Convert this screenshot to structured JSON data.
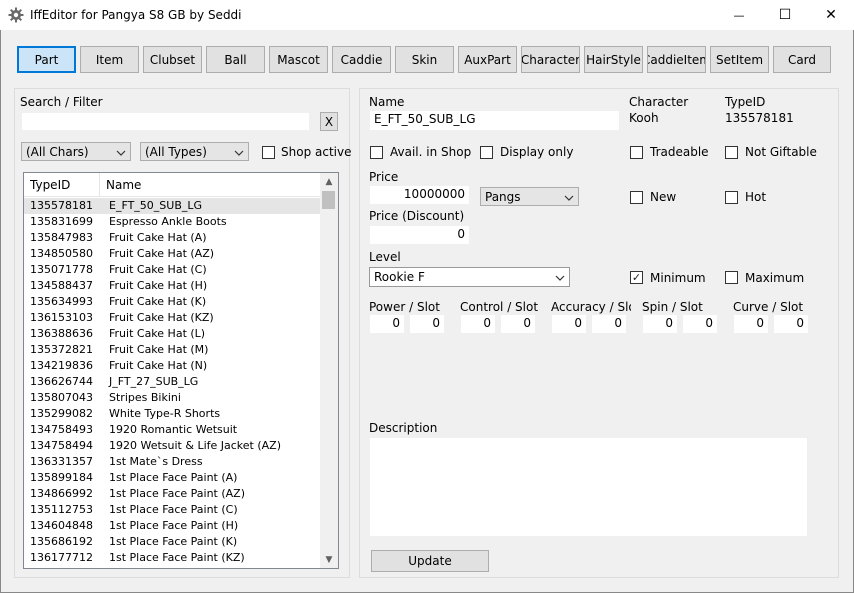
{
  "window": {
    "title": "IffEditor for Pangya S8 GB by Seddi",
    "minimize_glyph": "—",
    "maximize_glyph": "☐",
    "close_glyph": "✕"
  },
  "tabs": [
    "Part",
    "Item",
    "Clubset",
    "Ball",
    "Mascot",
    "Caddie",
    "Skin",
    "AuxPart",
    "Character",
    "HairStyle",
    "CaddieItem",
    "SetItem",
    "Card"
  ],
  "search": {
    "label": "Search / Filter",
    "value": "",
    "clear_label": "X",
    "char_filter": "(All Chars)",
    "type_filter": "(All Types)",
    "shop_active_label": "Shop active"
  },
  "list": {
    "col_typeid": "TypeID",
    "col_name": "Name",
    "scroll_up": "▲",
    "scroll_down": "▼",
    "rows": [
      {
        "id": "135578181",
        "name": "E_FT_50_SUB_LG"
      },
      {
        "id": "135831699",
        "name": "Espresso Ankle Boots"
      },
      {
        "id": "135847983",
        "name": "Fruit Cake Hat (A)"
      },
      {
        "id": "134850580",
        "name": "Fruit Cake Hat (AZ)"
      },
      {
        "id": "135071778",
        "name": "Fruit Cake Hat (C)"
      },
      {
        "id": "134588437",
        "name": "Fruit Cake Hat (H)"
      },
      {
        "id": "135634993",
        "name": "Fruit Cake Hat (K)"
      },
      {
        "id": "136153103",
        "name": "Fruit Cake Hat (KZ)"
      },
      {
        "id": "136388636",
        "name": "Fruit Cake Hat (L)"
      },
      {
        "id": "135372821",
        "name": "Fruit Cake Hat (M)"
      },
      {
        "id": "134219836",
        "name": "Fruit Cake Hat (N)"
      },
      {
        "id": "136626744",
        "name": "J_FT_27_SUB_LG"
      },
      {
        "id": "135807043",
        "name": "Stripes Bikini"
      },
      {
        "id": "135299082",
        "name": "White Type-R Shorts"
      },
      {
        "id": "134758493",
        "name": "1920 Romantic Wetsuit"
      },
      {
        "id": "134758494",
        "name": "1920 Wetsuit & Life Jacket (AZ)"
      },
      {
        "id": "136331357",
        "name": "1st Mate`s Dress"
      },
      {
        "id": "135899184",
        "name": "1st Place Face Paint (A)"
      },
      {
        "id": "134866992",
        "name": "1st Place Face Paint (AZ)"
      },
      {
        "id": "135112753",
        "name": "1st Place Face Paint (C)"
      },
      {
        "id": "134604848",
        "name": "1st Place Face Paint (H)"
      },
      {
        "id": "135686192",
        "name": "1st Place Face Paint (K)"
      },
      {
        "id": "136177712",
        "name": "1st Place Face Paint (KZ)"
      }
    ]
  },
  "details": {
    "name_label": "Name",
    "name_value": "E_FT_50_SUB_LG",
    "character_label": "Character",
    "character_value": "Kooh",
    "typeid_label": "TypeID",
    "typeid_value": "135578181",
    "avail_shop_label": "Avail. in Shop",
    "display_only_label": "Display only",
    "tradeable_label": "Tradeable",
    "not_giftable_label": "Not Giftable",
    "price_label": "Price",
    "price_value": "10000000",
    "currency": "Pangs",
    "new_label": "New",
    "hot_label": "Hot",
    "price_discount_label": "Price (Discount)",
    "price_discount_value": "0",
    "level_label": "Level",
    "level_value": "Rookie F",
    "minimum_label": "Minimum",
    "minimum_checked": true,
    "check_glyph": "✓",
    "maximum_label": "Maximum",
    "stats": [
      {
        "label": "Power / Slot",
        "a": "0",
        "b": "0"
      },
      {
        "label": "Control / Slot",
        "a": "0",
        "b": "0"
      },
      {
        "label": "Accuracy / Slot",
        "a": "0",
        "b": "0"
      },
      {
        "label": "Spin / Slot",
        "a": "0",
        "b": "0"
      },
      {
        "label": "Curve / Slot",
        "a": "0",
        "b": "0"
      }
    ],
    "description_label": "Description",
    "description_value": "",
    "update_label": "Update"
  }
}
